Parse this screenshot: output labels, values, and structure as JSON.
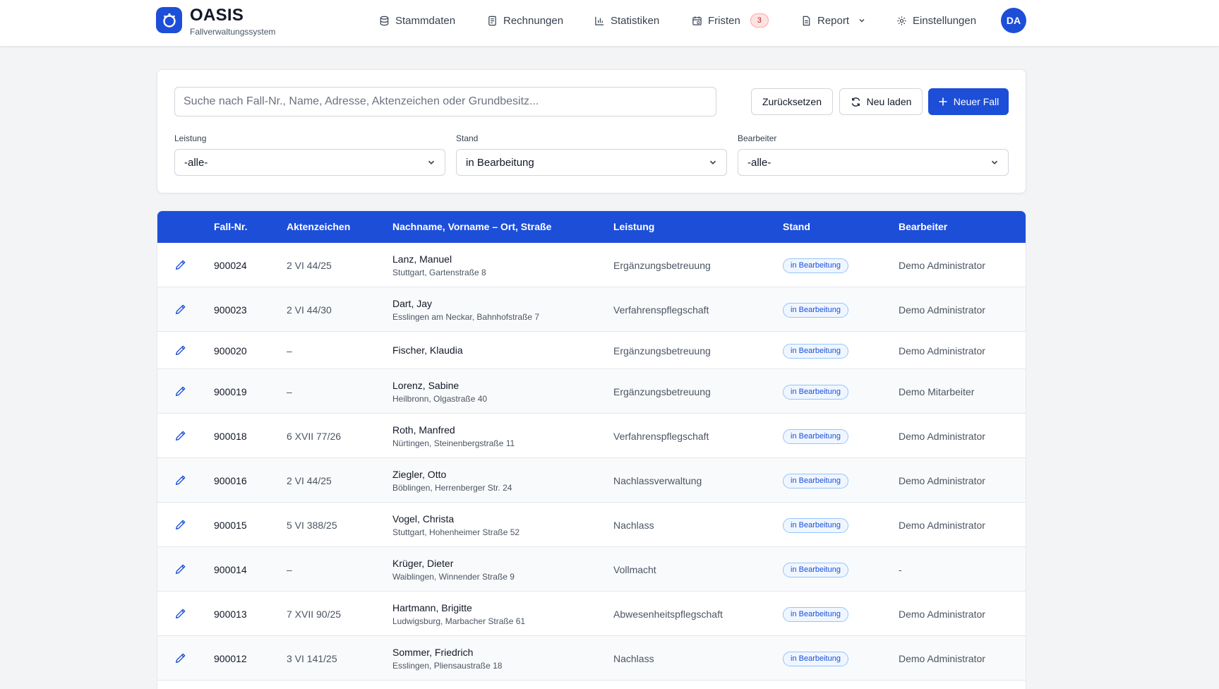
{
  "header": {
    "title": "OASIS",
    "subtitle": "Fallverwaltungssystem",
    "nav": [
      {
        "label": "Stammdaten",
        "icon": "database-icon"
      },
      {
        "label": "Rechnungen",
        "icon": "invoice-icon"
      },
      {
        "label": "Statistiken",
        "icon": "bar-chart-icon"
      },
      {
        "label": "Fristen",
        "icon": "calendar-icon",
        "badge": "3"
      },
      {
        "label": "Report",
        "icon": "document-icon"
      },
      {
        "label": "Einstellungen",
        "icon": "gear-icon"
      }
    ],
    "avatar": "DA"
  },
  "filters": {
    "search_placeholder": "Suche nach Fall-Nr., Name, Adresse, Aktenzeichen oder Grundbesitz...",
    "reset_label": "Zurücksetzen",
    "reload_label": "Neu laden",
    "new_label": "Neuer Fall",
    "leistung": {
      "label": "Leistung",
      "value": "-alle-"
    },
    "stand": {
      "label": "Stand",
      "value": "in Bearbeitung"
    },
    "bearbeiter": {
      "label": "Bearbeiter",
      "value": "-alle-"
    }
  },
  "table": {
    "headers": [
      "Fall-Nr.",
      "Aktenzeichen",
      "Nachname, Vorname – Ort, Straße",
      "Leistung",
      "Stand",
      "Bearbeiter"
    ],
    "rows": [
      {
        "fall": "900024",
        "akte": "2 VI 44/25",
        "name": "Lanz, Manuel",
        "addr": "Stuttgart, Gartenstraße 8",
        "leistung": "Ergänzungsbetreuung",
        "stand": "in Bearbeitung",
        "bearbeiter": "Demo Administrator"
      },
      {
        "fall": "900023",
        "akte": "2 VI 44/30",
        "name": "Dart, Jay",
        "addr": "Esslingen am Neckar, Bahnhofstraße 7",
        "leistung": "Verfahrenspflegschaft",
        "stand": "in Bearbeitung",
        "bearbeiter": "Demo Administrator"
      },
      {
        "fall": "900020",
        "akte": "–",
        "name": "Fischer, Klaudia",
        "addr": "",
        "leistung": "Ergänzungsbetreuung",
        "stand": "in Bearbeitung",
        "bearbeiter": "Demo Administrator"
      },
      {
        "fall": "900019",
        "akte": "–",
        "name": "Lorenz, Sabine",
        "addr": "Heilbronn, Olgastraße 40",
        "leistung": "Ergänzungsbetreuung",
        "stand": "in Bearbeitung",
        "bearbeiter": "Demo Mitarbeiter"
      },
      {
        "fall": "900018",
        "akte": "6 XVII 77/26",
        "name": "Roth, Manfred",
        "addr": "Nürtingen, Steinenbergstraße 11",
        "leistung": "Verfahrenspflegschaft",
        "stand": "in Bearbeitung",
        "bearbeiter": "Demo Administrator"
      },
      {
        "fall": "900016",
        "akte": "2 VI 44/25",
        "name": "Ziegler, Otto",
        "addr": "Böblingen, Herrenberger Str. 24",
        "leistung": "Nachlassverwaltung",
        "stand": "in Bearbeitung",
        "bearbeiter": "Demo Administrator"
      },
      {
        "fall": "900015",
        "akte": "5 VI 388/25",
        "name": "Vogel, Christa",
        "addr": "Stuttgart, Hohenheimer Straße 52",
        "leistung": "Nachlass",
        "stand": "in Bearbeitung",
        "bearbeiter": "Demo Administrator"
      },
      {
        "fall": "900014",
        "akte": "–",
        "name": "Krüger, Dieter",
        "addr": "Waiblingen, Winnender Straße 9",
        "leistung": "Vollmacht",
        "stand": "in Bearbeitung",
        "bearbeiter": "-"
      },
      {
        "fall": "900013",
        "akte": "7 XVII 90/25",
        "name": "Hartmann, Brigitte",
        "addr": "Ludwigsburg, Marbacher Straße 61",
        "leistung": "Abwesenheitspflegschaft",
        "stand": "in Bearbeitung",
        "bearbeiter": "Demo Administrator"
      },
      {
        "fall": "900012",
        "akte": "3 VI 141/25",
        "name": "Sommer, Friedrich",
        "addr": "Esslingen, Pliensaustraße 18",
        "leistung": "Nachlass",
        "stand": "in Bearbeitung",
        "bearbeiter": "Demo Administrator"
      }
    ]
  },
  "colors": {
    "primary": "#1d4ed8",
    "badge_bg": "#eff6ff",
    "alert": "#b91c1c"
  }
}
